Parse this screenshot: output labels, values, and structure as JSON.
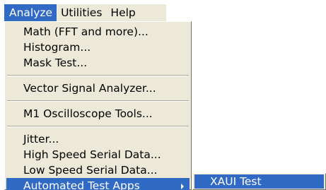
{
  "menubar": {
    "items": [
      {
        "label": "Analyze",
        "active": true
      },
      {
        "label": "Utilities",
        "active": false
      },
      {
        "label": "Help",
        "active": false
      }
    ]
  },
  "analyze_menu": {
    "groups": [
      {
        "items": [
          {
            "label": "Math (FFT and more)..."
          },
          {
            "label": "Histogram..."
          },
          {
            "label": "Mask Test..."
          }
        ]
      },
      {
        "items": [
          {
            "label": "Vector Signal Analyzer..."
          }
        ]
      },
      {
        "items": [
          {
            "label": "M1 Oscilloscope Tools..."
          }
        ]
      },
      {
        "items": [
          {
            "label": "Jitter..."
          },
          {
            "label": "High Speed Serial Data..."
          },
          {
            "label": "Low Speed Serial Data..."
          },
          {
            "label": "Automated Test Apps",
            "selected": true,
            "has_submenu": true
          }
        ]
      }
    ]
  },
  "submenu": {
    "items": [
      {
        "label": "XAUI Test",
        "selected": true
      }
    ]
  },
  "colors": {
    "menu_background": "#ece9d8",
    "highlight": "#316ac5",
    "highlight_text": "#ffffff"
  },
  "icons": {
    "submenu_indicator": "chevron-right-icon"
  }
}
